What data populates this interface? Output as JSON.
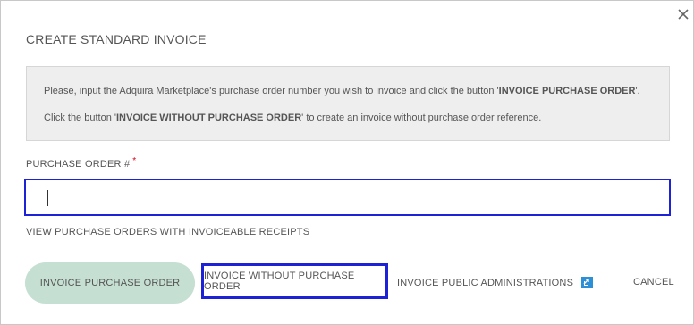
{
  "dialog": {
    "title": "CREATE STANDARD INVOICE",
    "close_icon": "close-icon"
  },
  "info": {
    "line1_prefix": "Please, input the Adquira Marketplace's purchase order number you wish to invoice and click the button '",
    "line1_bold": "INVOICE PURCHASE ORDER",
    "line1_suffix": "'.",
    "line2_prefix": "Click the button '",
    "line2_bold": "INVOICE WITHOUT PURCHASE ORDER",
    "line2_suffix": "' to create an invoice without purchase order reference."
  },
  "form": {
    "po_label": "PURCHASE ORDER #",
    "required_mark": "*",
    "po_value": ""
  },
  "links": {
    "view_receipts": "VIEW PURCHASE ORDERS WITH INVOICEABLE RECEIPTS"
  },
  "actions": {
    "invoice_po": "INVOICE PURCHASE ORDER",
    "invoice_without_po": "INVOICE WITHOUT PURCHASE ORDER",
    "invoice_public": "INVOICE PUBLIC ADMINISTRATIONS",
    "public_icon": "external-link-icon",
    "cancel": "CANCEL"
  },
  "colors": {
    "primary_button": "#c5dfd2",
    "highlight_border": "#1e22d6",
    "info_bg": "#eeeeee",
    "required": "#d9001b",
    "link_icon": "#2d8fd6"
  }
}
